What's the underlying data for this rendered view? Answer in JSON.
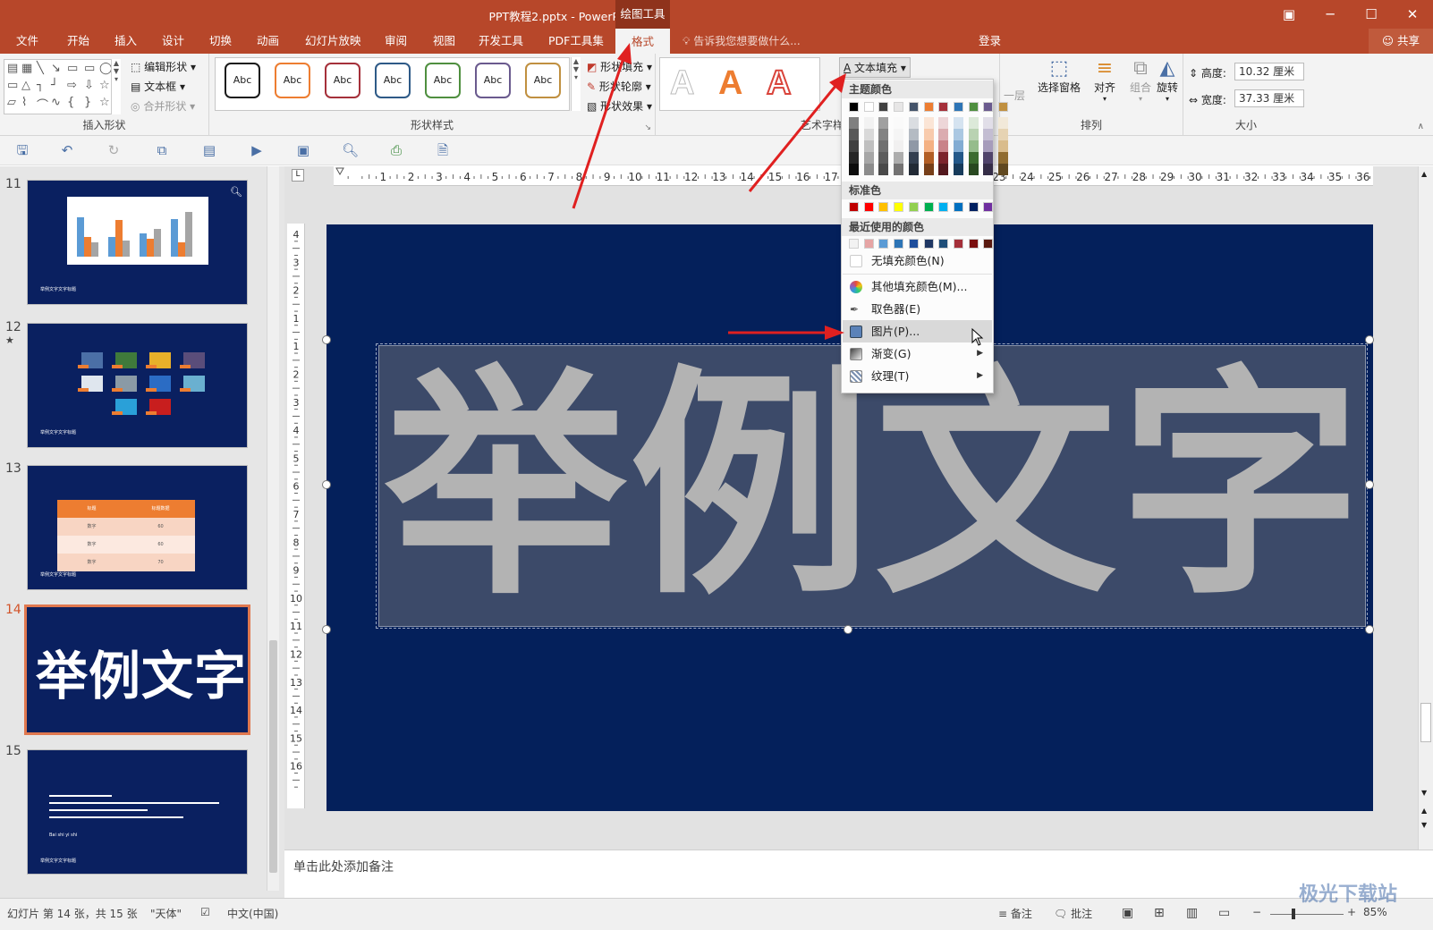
{
  "window": {
    "title": "PPT教程2.pptx - PowerPoint",
    "context_tab_group": "绘图工具",
    "icon_names": [
      "ribbon-display-icon",
      "minimize-icon",
      "maximize-icon",
      "close-icon"
    ]
  },
  "tabs": [
    "文件",
    "开始",
    "插入",
    "设计",
    "切换",
    "动画",
    "幻灯片放映",
    "审阅",
    "视图",
    "开发工具",
    "PDF工具集",
    "格式"
  ],
  "active_tab": "格式",
  "tell_me_placeholder": "告诉我您想要做什么...",
  "account": {
    "login": "登录",
    "share": "共享"
  },
  "ribbon": {
    "insert_shapes": {
      "edit_shape": "编辑形状",
      "text_box": "文本框",
      "merge_shapes": "合并形状",
      "label": "插入形状"
    },
    "shape_styles": {
      "sample_text": "Abc",
      "border_colors": [
        "#1a1a1a",
        "#ed7d31",
        "#a5303a",
        "#2e5a87",
        "#4f8f3f",
        "#6a5a8e",
        "#c09040"
      ],
      "shape_fill": "形状填充",
      "shape_outline": "形状轮廓",
      "shape_effects": "形状效果",
      "label": "形状样式"
    },
    "wordart_styles": {
      "sample_letter": "A",
      "text_fill": "文本填充",
      "label": "艺术字样式"
    },
    "arrange": {
      "bring_back": "一层",
      "selection_pane": "选择窗格",
      "align": "对齐",
      "group": "组合",
      "rotate": "旋转",
      "label": "排列"
    },
    "size": {
      "height_label": "高度:",
      "height_value": "10.32 厘米",
      "width_label": "宽度:",
      "width_value": "37.33 厘米",
      "label": "大小"
    }
  },
  "slides": [
    {
      "number": "11",
      "caption": "举例文字文字标题"
    },
    {
      "number": "12",
      "caption": "举例文字文字标题",
      "star": "★"
    },
    {
      "number": "13",
      "caption": "举例文字文字标题",
      "table": [
        [
          "标题",
          "标题数据"
        ],
        [
          "数字",
          "60"
        ],
        [
          "数字",
          "60"
        ],
        [
          "数字",
          "70"
        ]
      ]
    },
    {
      "number": "14",
      "headline": "举例文字"
    },
    {
      "number": "15",
      "caption": "举例文字文字标题",
      "footer_text": "Bai shi yi shi"
    }
  ],
  "current_slide": {
    "main_text": "举例文字"
  },
  "text_fill_menu": {
    "theme_colors_label": "主题颜色",
    "theme_top_row": [
      "#000000",
      "#ffffff",
      "#404040",
      "#e7e6e6",
      "#44546a",
      "#ed7d31",
      "#a5303a",
      "#2e75b6",
      "#4f8f3f",
      "#6a5a8e",
      "#c09040"
    ],
    "standard_colors_label": "标准色",
    "standard_colors": [
      "#c00000",
      "#ff0000",
      "#ffc000",
      "#ffff00",
      "#92d050",
      "#00b050",
      "#00b0f0",
      "#0070c0",
      "#002060",
      "#7030a0"
    ],
    "recent_colors_label": "最近使用的颜色",
    "recent_colors": [
      "#f2f2f2",
      "#e6a5a5",
      "#5b9bd5",
      "#2e75b6",
      "#1f4e9c",
      "#203864",
      "#1f4e79",
      "#a5303a",
      "#7b1010",
      "#5a1a10"
    ],
    "items": [
      {
        "label": "无填充颜色(N)",
        "icon": "no-fill-icon"
      },
      {
        "label": "其他填充颜色(M)...",
        "icon": "color-palette-icon"
      },
      {
        "label": "取色器(E)",
        "icon": "eyedropper-icon"
      },
      {
        "label": "图片(P)...",
        "icon": "picture-icon",
        "highlighted": true
      },
      {
        "label": "渐变(G)",
        "icon": "gradient-icon",
        "submenu": true
      },
      {
        "label": "纹理(T)",
        "icon": "texture-icon",
        "submenu": true
      }
    ]
  },
  "notes_placeholder": "单击此处添加备注",
  "status": {
    "slide_info": "幻灯片 第 14 张，共 15 张",
    "theme": "\"天体\"",
    "language": "中文(中国)",
    "notes_button": "备注",
    "comments_button": "批注",
    "zoom": "85%"
  },
  "ruler": {
    "h_numbers": [
      "1",
      "2",
      "3",
      "4",
      "5",
      "6",
      "7",
      "8",
      "9",
      "10",
      "11",
      "12",
      "13",
      "14",
      "15",
      "16",
      "17",
      "18",
      "19",
      "20",
      "21",
      "22",
      "23",
      "24",
      "25",
      "26",
      "27",
      "28",
      "29",
      "30",
      "31",
      "32",
      "33",
      "34",
      "35",
      "36"
    ],
    "v_numbers": [
      "4",
      "3",
      "2",
      "1",
      "1",
      "2",
      "3",
      "4",
      "5",
      "6",
      "7",
      "8",
      "9",
      "10",
      "11",
      "12",
      "13",
      "14",
      "15",
      "16"
    ]
  },
  "watermark": "极光下载站",
  "annotation_color": "#e02020"
}
